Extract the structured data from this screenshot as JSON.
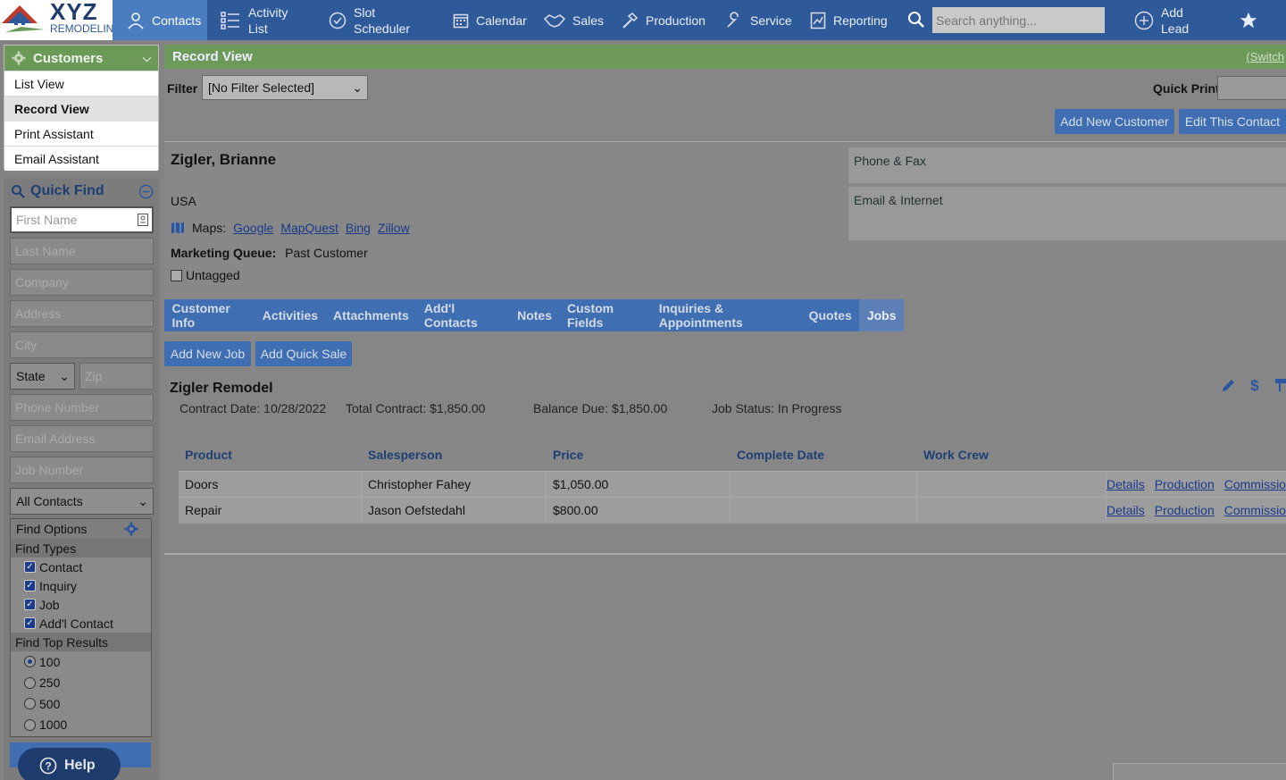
{
  "logo": {
    "brand": "XYZ",
    "sub": "REMODELING"
  },
  "nav": {
    "contacts": "Contacts",
    "activity_list": [
      "Activity",
      "List"
    ],
    "slot_scheduler": [
      "Slot",
      "Scheduler"
    ],
    "calendar": "Calendar",
    "sales": "Sales",
    "production": "Production",
    "service": "Service",
    "reporting": "Reporting",
    "search_placeholder": "Search anything...",
    "add_lead": [
      "Add",
      "Lead"
    ]
  },
  "sidebar": {
    "header": "Customers",
    "items": [
      "List View",
      "Record View",
      "Print Assistant",
      "Email Assistant"
    ],
    "selected": "Record View"
  },
  "quick_find": {
    "title": "Quick Find",
    "fields": [
      "First Name",
      "Last Name",
      "Company",
      "Address",
      "City"
    ],
    "state": "State",
    "zip": "Zip",
    "fields2": [
      "Phone Number",
      "Email Address",
      "Job Number"
    ],
    "contacts_select": "All Contacts",
    "find_options": "Find Options",
    "find_types_label": "Find Types",
    "find_types": [
      "Contact",
      "Inquiry",
      "Job",
      "Add'l Contact"
    ],
    "top_results_label": "Find Top Results",
    "top_results": [
      "100",
      "250",
      "500",
      "1000"
    ],
    "top_selected": "100",
    "help": "Help"
  },
  "record_view": {
    "title": "Record View",
    "switch": "(Switch",
    "filter_label": "Filter",
    "filter_value": "[No Filter Selected]",
    "quick_print": "Quick Print",
    "add_new_customer": "Add New Customer",
    "edit_contact": "Edit This Contact"
  },
  "contact": {
    "name": "Zigler, Brianne",
    "country": "USA",
    "maps_label": "Maps:",
    "maps_links": [
      "Google",
      "MapQuest",
      "Bing",
      "Zillow"
    ],
    "marketing_label": "Marketing Queue:",
    "marketing_value": "Past Customer",
    "untagged": "Untagged",
    "phone_fax": "Phone & Fax",
    "email_internet": "Email & Internet"
  },
  "tabs": [
    "Customer Info",
    "Activities",
    "Attachments",
    "Add'l Contacts",
    "Notes",
    "Custom Fields",
    "Inquiries & Appointments",
    "Quotes",
    "Jobs"
  ],
  "tab_selected": "Jobs",
  "jobs": {
    "add_new_job": "Add New Job",
    "add_quick_sale": "Add Quick Sale",
    "job_title": "Zigler Remodel",
    "contract_date": "Contract Date: 10/28/2022",
    "total_contract": "Total Contract: $1,850.00",
    "balance_due": "Balance Due: $1,850.00",
    "job_status": "Job Status: In Progress",
    "columns": [
      "Product",
      "Salesperson",
      "Price",
      "Complete Date",
      "Work Crew"
    ],
    "rows": [
      {
        "product": "Doors",
        "salesperson": "Christopher Fahey",
        "price": "$1,050.00",
        "complete_date": "",
        "work_crew": ""
      },
      {
        "product": "Repair",
        "salesperson": "Jason Oefstedahl",
        "price": "$800.00",
        "complete_date": "",
        "work_crew": ""
      }
    ],
    "row_links": [
      "Details",
      "Production",
      "Commissio"
    ]
  },
  "colors": {
    "nav": "#2f5a9a",
    "green_header": "#6d995a",
    "button": "#3f6fb2",
    "overlay": "#838383"
  }
}
